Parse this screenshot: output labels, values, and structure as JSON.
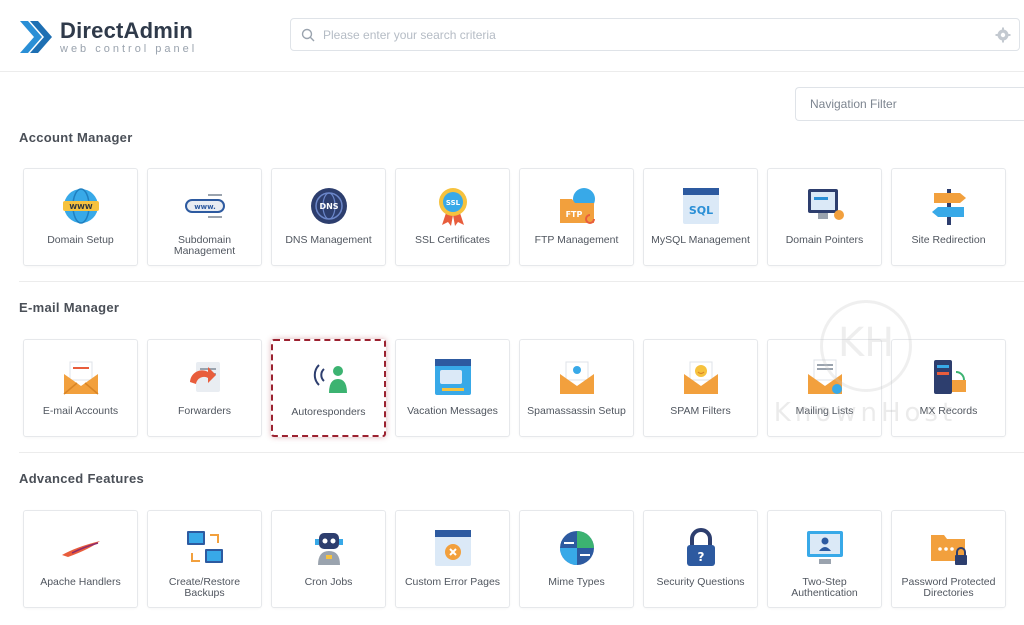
{
  "header": {
    "brand": "DirectAdmin",
    "brand_sub": "web control panel",
    "search_placeholder": "Please enter your search criteria"
  },
  "nav_filter": {
    "placeholder": "Navigation Filter"
  },
  "sections": [
    {
      "title": "Account Manager",
      "items": [
        {
          "label": "Domain Setup",
          "icon": "www-globe-icon"
        },
        {
          "label": "Subdomain Management",
          "icon": "subdomain-icon"
        },
        {
          "label": "DNS Management",
          "icon": "dns-icon"
        },
        {
          "label": "SSL Certificates",
          "icon": "ssl-badge-icon"
        },
        {
          "label": "FTP Management",
          "icon": "ftp-folder-icon"
        },
        {
          "label": "MySQL Management",
          "icon": "sql-window-icon"
        },
        {
          "label": "Domain Pointers",
          "icon": "domain-pointer-icon"
        },
        {
          "label": "Site Redirection",
          "icon": "signpost-icon"
        }
      ]
    },
    {
      "title": "E-mail Manager",
      "items": [
        {
          "label": "E-mail Accounts",
          "icon": "envelope-icon"
        },
        {
          "label": "Forwarders",
          "icon": "forward-arrow-icon"
        },
        {
          "label": "Autoresponders",
          "icon": "broadcast-user-icon",
          "highlighted": true
        },
        {
          "label": "Vacation Messages",
          "icon": "message-window-icon"
        },
        {
          "label": "Spamassassin Setup",
          "icon": "spam-envelope-icon"
        },
        {
          "label": "SPAM Filters",
          "icon": "smiley-envelope-icon"
        },
        {
          "label": "Mailing Lists",
          "icon": "list-envelope-icon"
        },
        {
          "label": "MX Records",
          "icon": "mx-server-icon"
        }
      ]
    },
    {
      "title": "Advanced Features",
      "items": [
        {
          "label": "Apache Handlers",
          "icon": "apache-feather-icon"
        },
        {
          "label": "Create/Restore Backups",
          "icon": "backup-computers-icon"
        },
        {
          "label": "Cron Jobs",
          "icon": "robot-icon"
        },
        {
          "label": "Custom Error Pages",
          "icon": "error-page-icon"
        },
        {
          "label": "Mime Types",
          "icon": "mime-globe-icon"
        },
        {
          "label": "Security Questions",
          "icon": "padlock-question-icon"
        },
        {
          "label": "Two-Step Authentication",
          "icon": "monitor-user-icon"
        },
        {
          "label": "Password Protected Directories",
          "icon": "locked-folder-icon"
        }
      ]
    }
  ],
  "watermark": {
    "initials": "KH",
    "text": "KnownHost"
  },
  "colors": {
    "brand_blue": "#2a8fd6",
    "highlight": "#9b2230",
    "orange": "#f2a03d"
  }
}
